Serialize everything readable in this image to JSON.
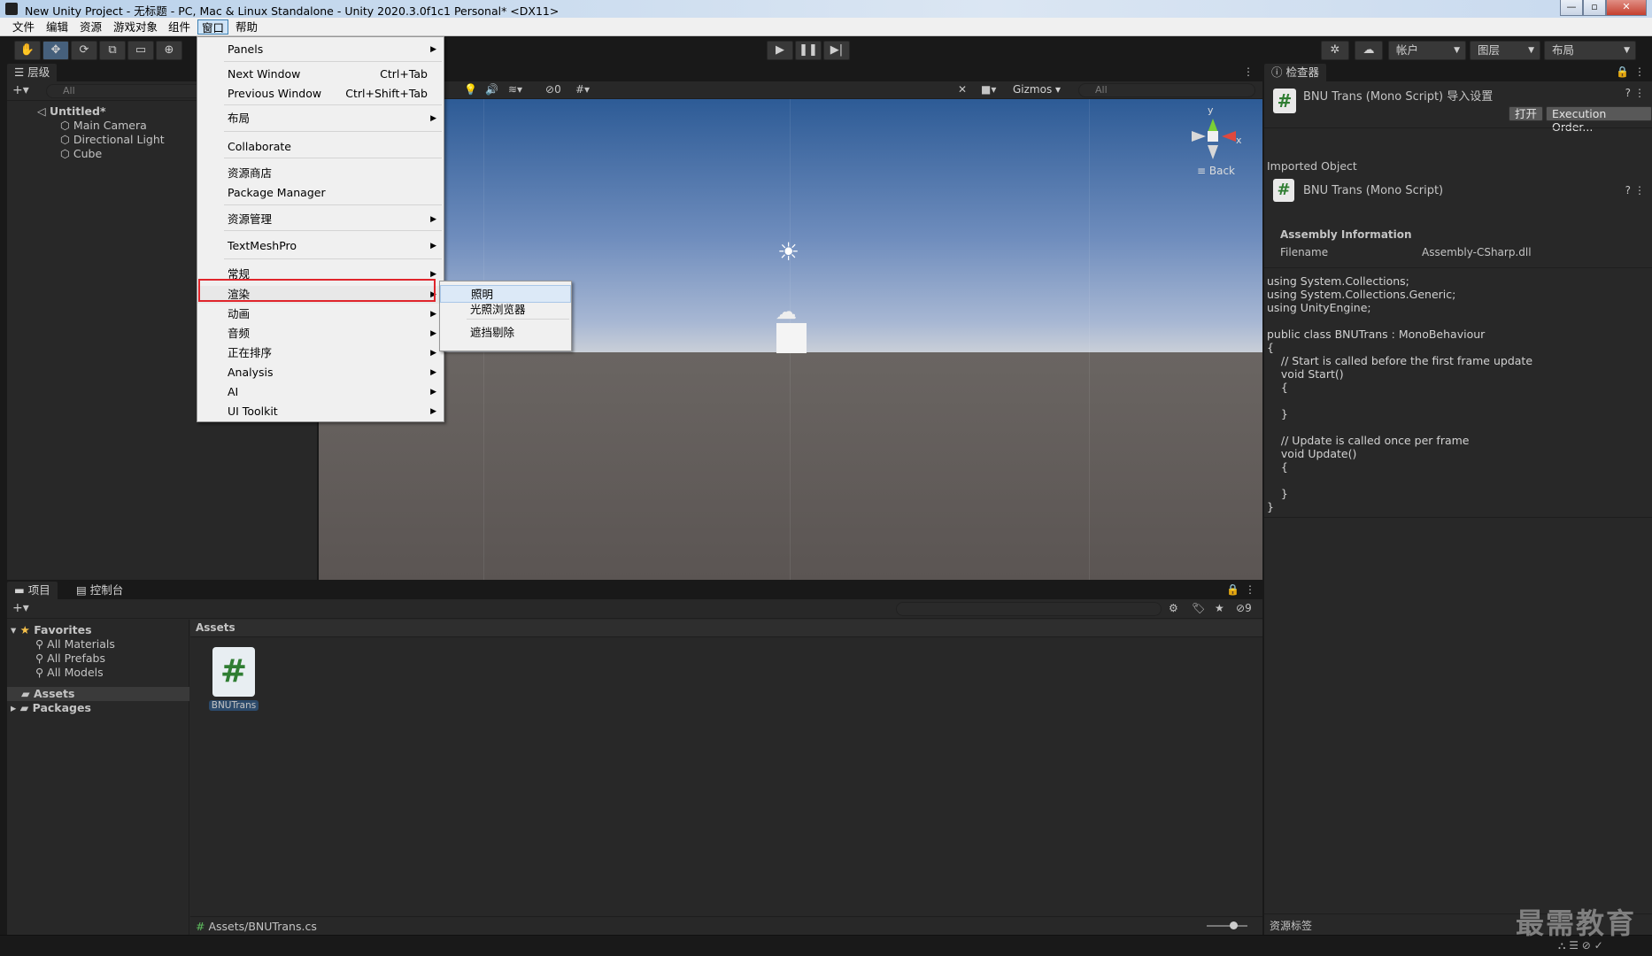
{
  "window": {
    "title": "New Unity Project - 无标题 - PC, Mac & Linux Standalone - Unity 2020.3.0f1c1 Personal* <DX11>"
  },
  "menubar": [
    "文件",
    "编辑",
    "资源",
    "游戏对象",
    "组件",
    "窗口",
    "帮助"
  ],
  "menubar_active": "窗口",
  "toolbar": {
    "account": "帐户",
    "layers": "图层",
    "layout": "布局"
  },
  "hierarchy": {
    "tab": "层级",
    "search_placeholder": "All",
    "scene": "Untitled*",
    "objects": [
      "Main Camera",
      "Directional Light",
      "Cube"
    ]
  },
  "scene_toolbar": {
    "hidden_count": "0",
    "gizmos": "Gizmos",
    "search_placeholder": "All",
    "gizmo_y": "y",
    "gizmo_x": "x",
    "view_label": "Back"
  },
  "window_menu": {
    "items": [
      {
        "label": "Panels",
        "shortcut": "",
        "submenu": true
      },
      {
        "label": "Next Window",
        "shortcut": "Ctrl+Tab",
        "submenu": false
      },
      {
        "label": "Previous Window",
        "shortcut": "Ctrl+Shift+Tab",
        "submenu": false
      },
      {
        "label": "布局",
        "shortcut": "",
        "submenu": true
      },
      {
        "label": "Collaborate",
        "shortcut": "",
        "submenu": false
      },
      {
        "label": "资源商店",
        "shortcut": "",
        "submenu": false
      },
      {
        "label": "Package Manager",
        "shortcut": "",
        "submenu": false
      },
      {
        "label": "资源管理",
        "shortcut": "",
        "submenu": true
      },
      {
        "label": "TextMeshPro",
        "shortcut": "",
        "submenu": true
      },
      {
        "label": "常规",
        "shortcut": "",
        "submenu": true
      },
      {
        "label": "渲染",
        "shortcut": "",
        "submenu": true
      },
      {
        "label": "动画",
        "shortcut": "",
        "submenu": true
      },
      {
        "label": "音频",
        "shortcut": "",
        "submenu": true
      },
      {
        "label": "正在排序",
        "shortcut": "",
        "submenu": true
      },
      {
        "label": "Analysis",
        "shortcut": "",
        "submenu": true
      },
      {
        "label": "AI",
        "shortcut": "",
        "submenu": true
      },
      {
        "label": "UI Toolkit",
        "shortcut": "",
        "submenu": true
      }
    ],
    "highlighted": "渲染"
  },
  "render_submenu": [
    "照明",
    "光照浏览器",
    "遮挡剔除"
  ],
  "inspector": {
    "tab": "检查器",
    "header_title": "BNU Trans (Mono Script) 导入设置",
    "open_button": "打开",
    "execution_order_button": "Execution Order...",
    "imported_object": "Imported Object",
    "script_title": "BNU Trans (Mono Script)",
    "assembly_heading": "Assembly Information",
    "filename_label": "Filename",
    "filename_value": "Assembly-CSharp.dll",
    "code_lines": [
      "using System.Collections;",
      "using System.Collections.Generic;",
      "using UnityEngine;",
      "",
      "public class BNUTrans : MonoBehaviour",
      "{",
      "    // Start is called before the first frame update",
      "    void Start()",
      "    {",
      "",
      "    }",
      "",
      "    // Update is called once per frame",
      "    void Update()",
      "    {",
      "",
      "    }",
      "}"
    ],
    "asset_labels": "资源标签"
  },
  "project": {
    "tab_project": "项目",
    "tab_console": "控制台",
    "hidden_count": "9",
    "favorites_label": "Favorites",
    "favorites": [
      "All Materials",
      "All Prefabs",
      "All Models"
    ],
    "folders": [
      "Assets",
      "Packages"
    ],
    "breadcrumb": "Assets",
    "asset_name": "BNUTrans",
    "status_path": "Assets/BNUTrans.cs"
  },
  "watermark": "最需教育",
  "colors": {
    "menu_highlight_border": "#e0252b",
    "selection": "#46607c"
  }
}
